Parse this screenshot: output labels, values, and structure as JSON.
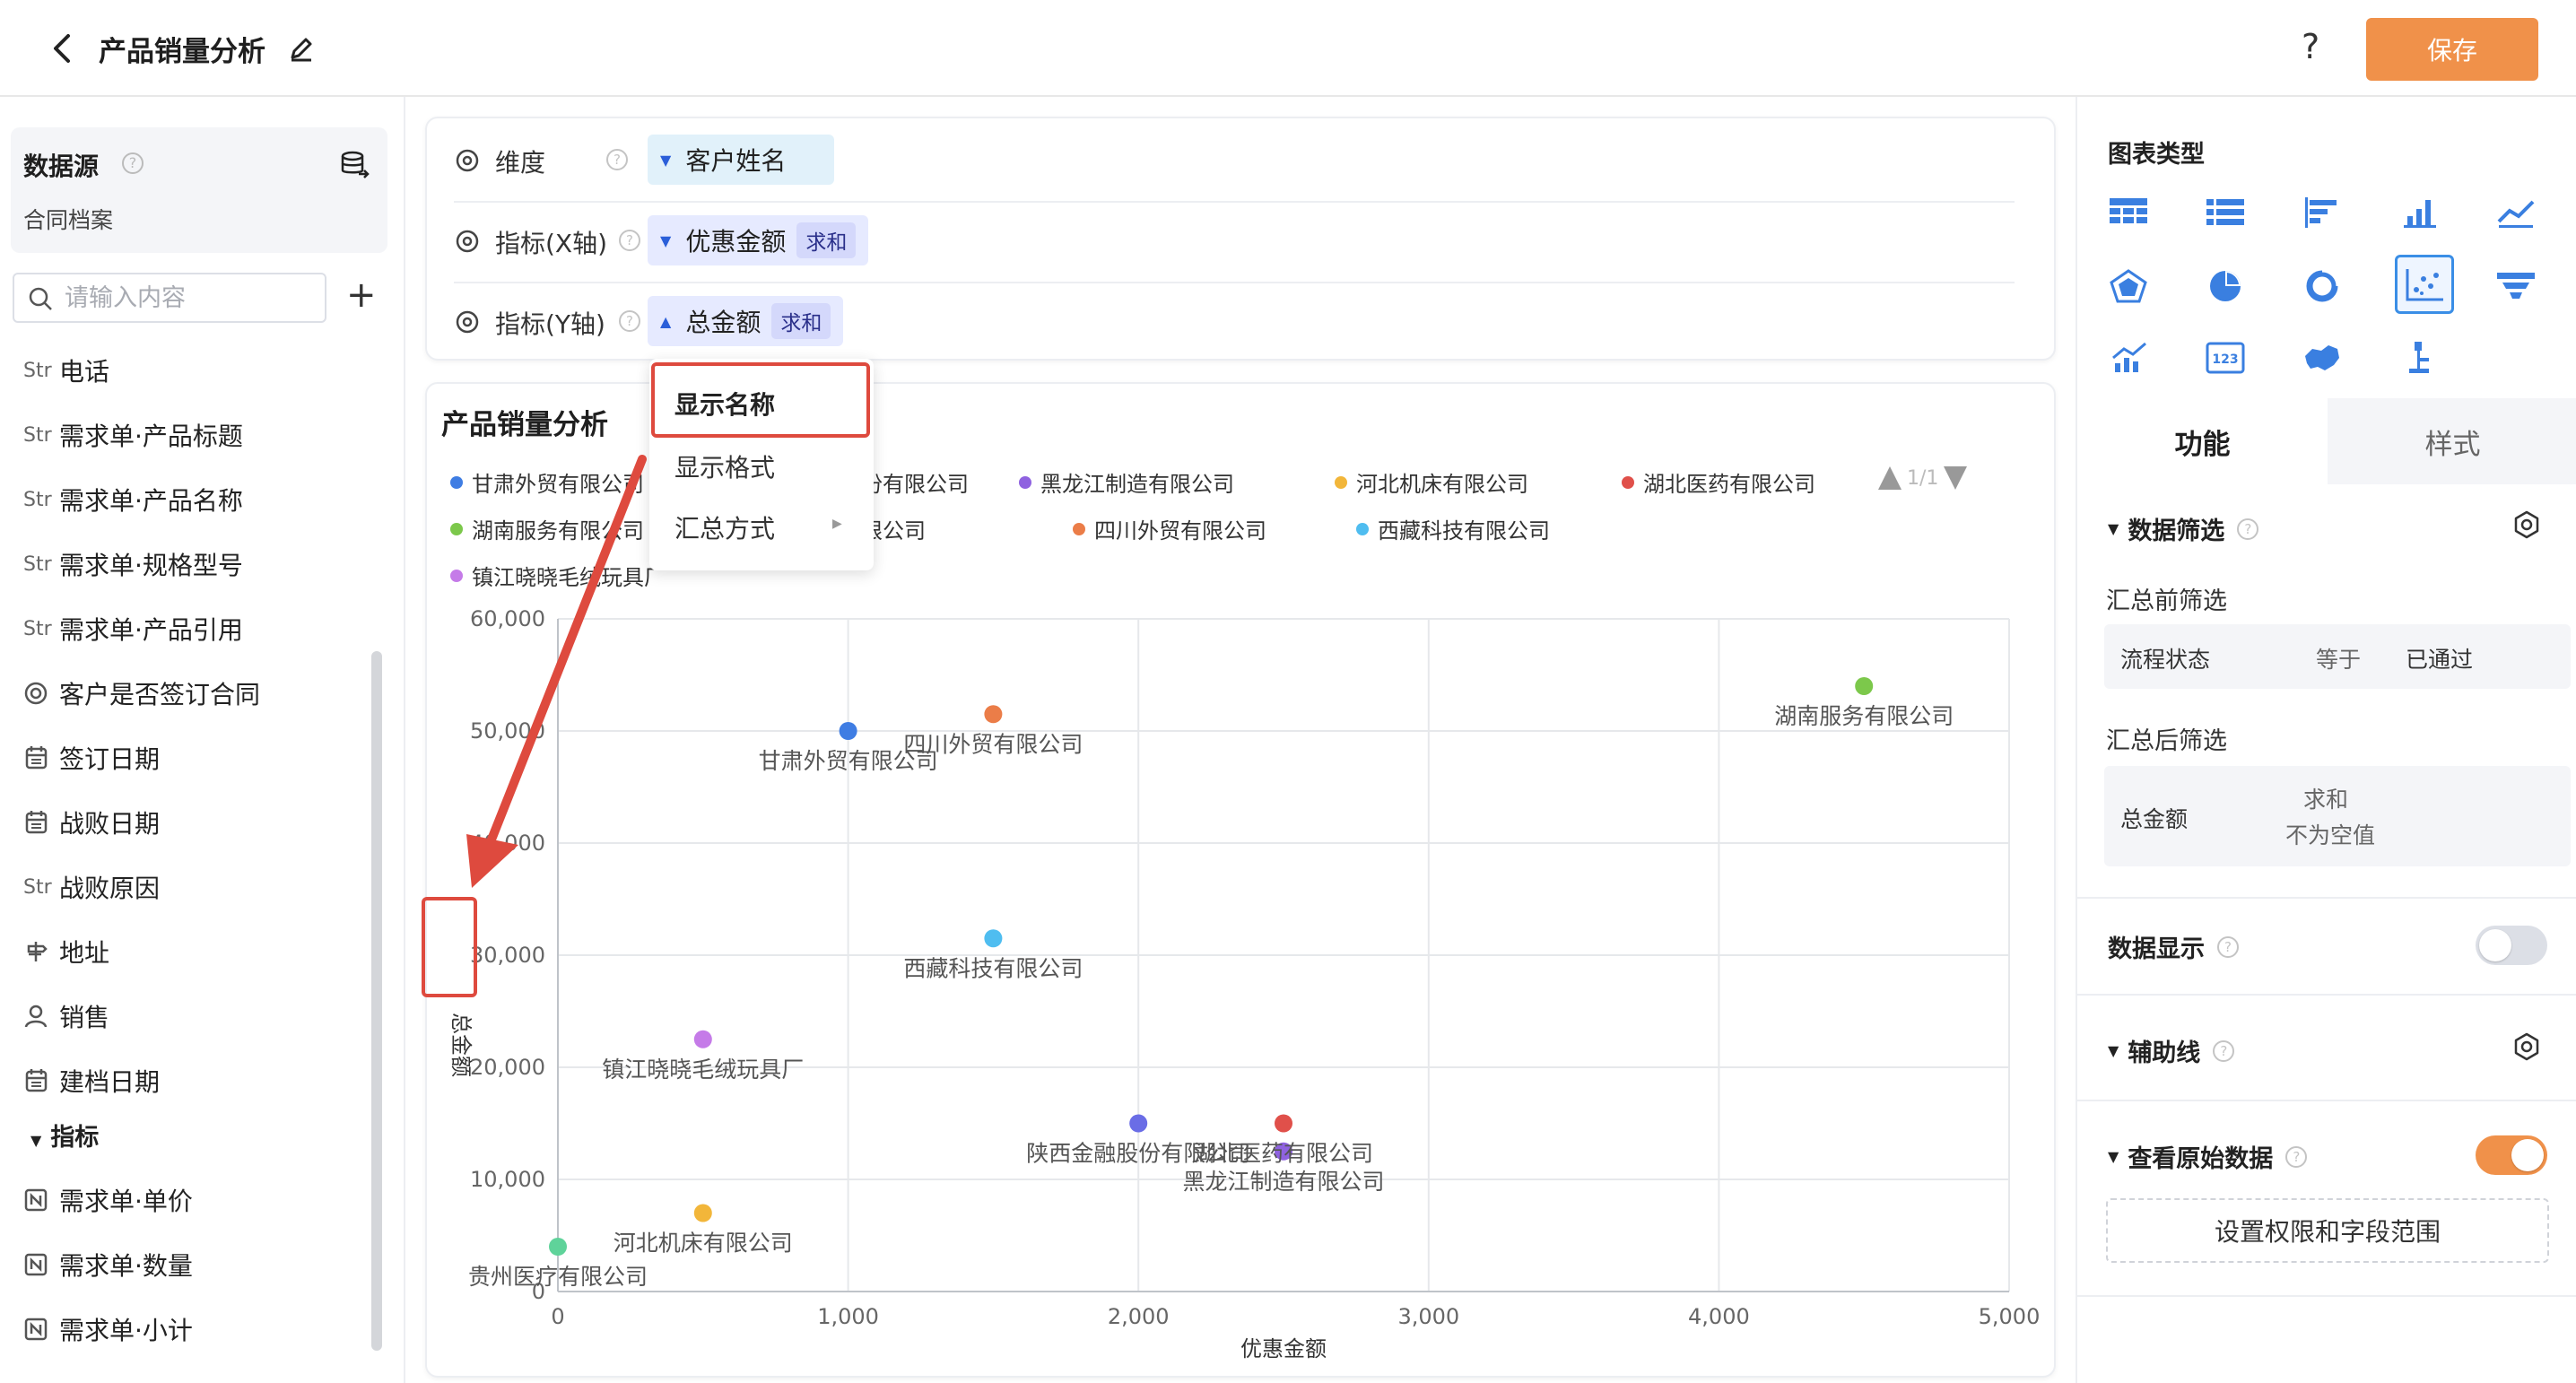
{
  "header": {
    "title": "产品销量分析",
    "help": "?",
    "save_label": "保存"
  },
  "left": {
    "datasource_title": "数据源",
    "datasource_help": "?",
    "datasource_name": "合同档案",
    "search_placeholder": "请输入内容",
    "fields": [
      {
        "type": "Str",
        "label": "电话"
      },
      {
        "type": "Str",
        "label": "需求单·产品标题"
      },
      {
        "type": "Str",
        "label": "需求单·产品名称"
      },
      {
        "type": "Str",
        "label": "需求单·规格型号"
      },
      {
        "type": "Str",
        "label": "需求单·产品引用"
      },
      {
        "type": "radio-icon",
        "label": "客户是否签订合同"
      },
      {
        "type": "calendar-icon",
        "label": "签订日期"
      },
      {
        "type": "calendar-icon",
        "label": "战败日期"
      },
      {
        "type": "Str",
        "label": "战败原因"
      },
      {
        "type": "location-icon",
        "label": "地址"
      },
      {
        "type": "person-icon",
        "label": "销售"
      },
      {
        "type": "calendar-icon",
        "label": "建档日期"
      }
    ],
    "group_label": "指标",
    "metrics": [
      {
        "type": "N",
        "label": "需求单·单价"
      },
      {
        "type": "N",
        "label": "需求单·数量"
      },
      {
        "type": "N",
        "label": "需求单·小计"
      }
    ]
  },
  "config": {
    "dimension": {
      "label": "维度",
      "help": "?",
      "value": "客户姓名"
    },
    "x_metric": {
      "label": "指标(X轴)",
      "help": "?",
      "value": "优惠金额",
      "agg": "求和"
    },
    "y_metric": {
      "label": "指标(Y轴)",
      "help": "?",
      "value": "总金额",
      "agg": "求和"
    }
  },
  "menu": {
    "items": [
      "显示名称",
      "显示格式",
      "汇总方式"
    ]
  },
  "chart": {
    "title": "产品销量分析",
    "legend_page": "1/1"
  },
  "chart_data": {
    "type": "scatter",
    "title": "产品销量分析",
    "xlabel": "优惠金额",
    "ylabel": "总金额",
    "xlim": [
      0,
      5000
    ],
    "ylim": [
      0,
      60000
    ],
    "x_ticks": [
      "0",
      "1,000",
      "2,000",
      "3,000",
      "4,000",
      "5,000"
    ],
    "y_ticks": [
      "0",
      "10,000",
      "20,000",
      "30,000",
      "40,000",
      "50,000",
      "60,000"
    ],
    "grid": true,
    "legend_position": "top",
    "series": [
      {
        "name": "甘肃外贸有限公司",
        "color": "#3f7de3",
        "x": 1000,
        "y": 50000
      },
      {
        "name": "陕西金融股份有限公司",
        "color": "#6a6de6",
        "x": 2000,
        "y": 15000
      },
      {
        "name": "黑龙江制造有限公司",
        "color": "#8f62e0",
        "x": 2500,
        "y": 12500
      },
      {
        "name": "河北机床有限公司",
        "color": "#f2b63a",
        "x": 500,
        "y": 7000
      },
      {
        "name": "湖北医药有限公司",
        "color": "#e0504a",
        "x": 2500,
        "y": 15000
      },
      {
        "name": "湖南服务有限公司",
        "color": "#7cc84b",
        "x": 4500,
        "y": 54000
      },
      {
        "name": "贵州医疗有限公司",
        "color": "#5fd39a",
        "x": 0,
        "y": 4000
      },
      {
        "name": "四川外贸有限公司",
        "color": "#eb7d48",
        "x": 1500,
        "y": 51500
      },
      {
        "name": "西藏科技有限公司",
        "color": "#4fbdf0",
        "x": 1500,
        "y": 31500
      },
      {
        "name": "镇江晓晓毛绒玩具厂",
        "color": "#c57be8",
        "x": 500,
        "y": 22500
      }
    ]
  },
  "right": {
    "chart_type_title": "图表类型",
    "tabs": [
      "功能",
      "样式"
    ],
    "data_filter": {
      "title": "数据筛选",
      "help": "?"
    },
    "pre_filter_label": "汇总前筛选",
    "pre_filter": {
      "field": "流程状态",
      "op": "等于",
      "value": "已通过"
    },
    "post_filter_label": "汇总后筛选",
    "post_filter": {
      "field": "总金额",
      "agg": "求和",
      "cond": "不为空值"
    },
    "data_display": {
      "title": "数据显示",
      "help": "?",
      "on": false
    },
    "aux_line": {
      "title": "辅助线",
      "help": "?"
    },
    "raw_data": {
      "title": "查看原始数据",
      "help": "?",
      "on": true
    },
    "perm_button": "设置权限和字段范围"
  }
}
